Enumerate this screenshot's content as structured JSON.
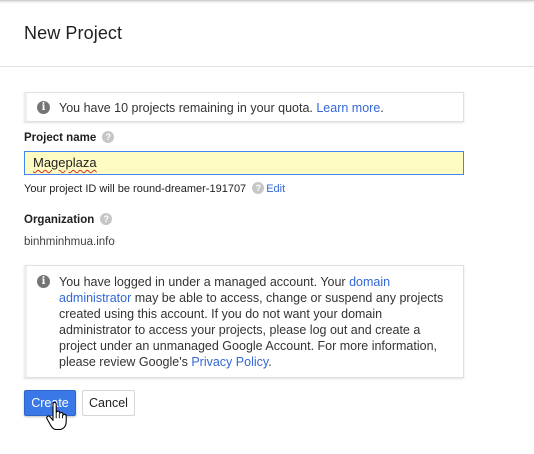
{
  "dialog": {
    "title": "New Project"
  },
  "quota_notice": {
    "text": "You have 10 projects remaining in your quota. ",
    "link": "Learn more",
    "suffix": "."
  },
  "project_name": {
    "label": "Project name",
    "value": "Mageplaza"
  },
  "project_id": {
    "prefix": "Your project ID will be",
    "id": "round-dreamer-191707",
    "edit_label": "Edit"
  },
  "organization": {
    "label": "Organization",
    "value": "binhminhmua.info"
  },
  "managed_notice": {
    "part1": "You have logged in under a managed account. Your ",
    "link1": "domain administrator",
    "part2": " may be able to access, change or suspend any projects created using this account. If you do not want your domain administrator to access your projects, please log out and create a project under an unmanaged Google Account. For more information, please review Google's ",
    "link2": "Privacy Policy",
    "part3": "."
  },
  "buttons": {
    "create": "Create",
    "cancel": "Cancel"
  },
  "icons": {
    "info": "info-icon",
    "help": "help-icon",
    "cursor": "hand-pointer-icon"
  },
  "colors": {
    "primary": "#3b78e7",
    "link": "#3367d6",
    "input_autofill_bg": "#fefcc2",
    "input_focus_border": "#4285f4"
  }
}
